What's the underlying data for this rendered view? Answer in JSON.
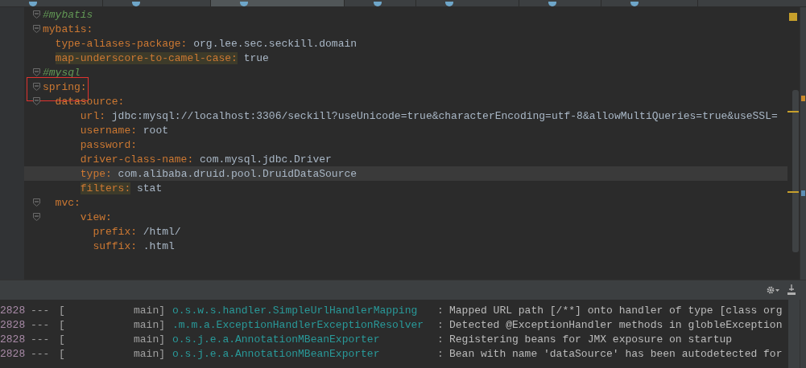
{
  "tabs": [
    {
      "selected": false
    },
    {
      "selected": false
    },
    {
      "selected": true
    },
    {
      "selected": false
    },
    {
      "selected": false
    },
    {
      "selected": false
    },
    {
      "selected": false
    }
  ],
  "editor": {
    "lines": [
      {
        "text": "#mybatis"
      },
      {
        "key": "mybatis:",
        "children": [
          {
            "key": "type-aliases-package:",
            "value": "org.lee.sec.seckill.domain"
          },
          {
            "key": "map-underscore-to-camel-case:",
            "value": "true",
            "highlighted": true
          }
        ]
      },
      {
        "text": "#mysql"
      },
      {
        "key": "spring:",
        "marked": true,
        "children": [
          {
            "key": "datasource:",
            "children": [
              {
                "key": "url:",
                "value": "jdbc:mysql://localhost:3306/seckill?useUnicode=true&characterEncoding=utf-8&allowMultiQueries=true&useSSL="
              },
              {
                "key": "username:",
                "value": "root"
              },
              {
                "key": "password:"
              },
              {
                "key": "driver-class-name:",
                "value": "com.mysql.jdbc.Driver"
              },
              {
                "key": "type:",
                "value": "com.alibaba.druid.pool.DruidDataSource",
                "current": true
              },
              {
                "key": "filters:",
                "value": "stat",
                "highlighted": true
              }
            ]
          },
          {
            "key": "mvc:",
            "children": [
              {
                "key": "view:",
                "children": [
                  {
                    "key": "prefix:",
                    "value": "/html/"
                  },
                  {
                    "key": "suffix:",
                    "value": ".html"
                  }
                ]
              }
            ]
          }
        ]
      }
    ]
  },
  "console": {
    "lines": [
      {
        "pid": "2828",
        "sep": "---",
        "bracket": "[",
        "thread": "main]",
        "logger": "o.s.w.s.handler.SimpleUrlHandlerMapping",
        "colon": ":",
        "message": "Mapped URL path [/**] onto handler of type [class org"
      },
      {
        "pid": "2828",
        "sep": "---",
        "bracket": "[",
        "thread": "main]",
        "logger": ".m.m.a.ExceptionHandlerExceptionResolver",
        "colon": ":",
        "message": "Detected @ExceptionHandler methods in globleException"
      },
      {
        "pid": "2828",
        "sep": "---",
        "bracket": "[",
        "thread": "main]",
        "logger": "o.s.j.e.a.AnnotationMBeanExporter",
        "colon": ":",
        "message": "Registering beans for JMX exposure on startup"
      },
      {
        "pid": "2828",
        "sep": "---",
        "bracket": "[",
        "thread": "main]",
        "logger": "o.s.j.e.a.AnnotationMBeanExporter",
        "colon": ":",
        "message": "Bean with name 'dataSource' has been autodetected for"
      }
    ]
  }
}
